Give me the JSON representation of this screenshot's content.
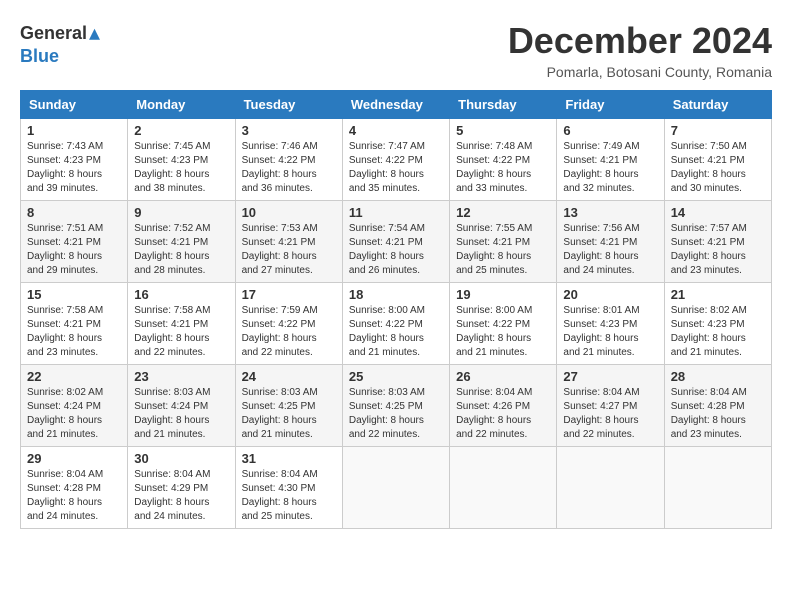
{
  "header": {
    "logo_general": "General",
    "logo_blue": "Blue",
    "month_title": "December 2024",
    "subtitle": "Pomarla, Botosani County, Romania"
  },
  "days_of_week": [
    "Sunday",
    "Monday",
    "Tuesday",
    "Wednesday",
    "Thursday",
    "Friday",
    "Saturday"
  ],
  "weeks": [
    [
      {
        "day": "1",
        "sunrise": "7:43 AM",
        "sunset": "4:23 PM",
        "daylight": "8 hours and 39 minutes."
      },
      {
        "day": "2",
        "sunrise": "7:45 AM",
        "sunset": "4:23 PM",
        "daylight": "8 hours and 38 minutes."
      },
      {
        "day": "3",
        "sunrise": "7:46 AM",
        "sunset": "4:22 PM",
        "daylight": "8 hours and 36 minutes."
      },
      {
        "day": "4",
        "sunrise": "7:47 AM",
        "sunset": "4:22 PM",
        "daylight": "8 hours and 35 minutes."
      },
      {
        "day": "5",
        "sunrise": "7:48 AM",
        "sunset": "4:22 PM",
        "daylight": "8 hours and 33 minutes."
      },
      {
        "day": "6",
        "sunrise": "7:49 AM",
        "sunset": "4:21 PM",
        "daylight": "8 hours and 32 minutes."
      },
      {
        "day": "7",
        "sunrise": "7:50 AM",
        "sunset": "4:21 PM",
        "daylight": "8 hours and 30 minutes."
      }
    ],
    [
      {
        "day": "8",
        "sunrise": "7:51 AM",
        "sunset": "4:21 PM",
        "daylight": "8 hours and 29 minutes."
      },
      {
        "day": "9",
        "sunrise": "7:52 AM",
        "sunset": "4:21 PM",
        "daylight": "8 hours and 28 minutes."
      },
      {
        "day": "10",
        "sunrise": "7:53 AM",
        "sunset": "4:21 PM",
        "daylight": "8 hours and 27 minutes."
      },
      {
        "day": "11",
        "sunrise": "7:54 AM",
        "sunset": "4:21 PM",
        "daylight": "8 hours and 26 minutes."
      },
      {
        "day": "12",
        "sunrise": "7:55 AM",
        "sunset": "4:21 PM",
        "daylight": "8 hours and 25 minutes."
      },
      {
        "day": "13",
        "sunrise": "7:56 AM",
        "sunset": "4:21 PM",
        "daylight": "8 hours and 24 minutes."
      },
      {
        "day": "14",
        "sunrise": "7:57 AM",
        "sunset": "4:21 PM",
        "daylight": "8 hours and 23 minutes."
      }
    ],
    [
      {
        "day": "15",
        "sunrise": "7:58 AM",
        "sunset": "4:21 PM",
        "daylight": "8 hours and 23 minutes."
      },
      {
        "day": "16",
        "sunrise": "7:58 AM",
        "sunset": "4:21 PM",
        "daylight": "8 hours and 22 minutes."
      },
      {
        "day": "17",
        "sunrise": "7:59 AM",
        "sunset": "4:22 PM",
        "daylight": "8 hours and 22 minutes."
      },
      {
        "day": "18",
        "sunrise": "8:00 AM",
        "sunset": "4:22 PM",
        "daylight": "8 hours and 21 minutes."
      },
      {
        "day": "19",
        "sunrise": "8:00 AM",
        "sunset": "4:22 PM",
        "daylight": "8 hours and 21 minutes."
      },
      {
        "day": "20",
        "sunrise": "8:01 AM",
        "sunset": "4:23 PM",
        "daylight": "8 hours and 21 minutes."
      },
      {
        "day": "21",
        "sunrise": "8:02 AM",
        "sunset": "4:23 PM",
        "daylight": "8 hours and 21 minutes."
      }
    ],
    [
      {
        "day": "22",
        "sunrise": "8:02 AM",
        "sunset": "4:24 PM",
        "daylight": "8 hours and 21 minutes."
      },
      {
        "day": "23",
        "sunrise": "8:03 AM",
        "sunset": "4:24 PM",
        "daylight": "8 hours and 21 minutes."
      },
      {
        "day": "24",
        "sunrise": "8:03 AM",
        "sunset": "4:25 PM",
        "daylight": "8 hours and 21 minutes."
      },
      {
        "day": "25",
        "sunrise": "8:03 AM",
        "sunset": "4:25 PM",
        "daylight": "8 hours and 22 minutes."
      },
      {
        "day": "26",
        "sunrise": "8:04 AM",
        "sunset": "4:26 PM",
        "daylight": "8 hours and 22 minutes."
      },
      {
        "day": "27",
        "sunrise": "8:04 AM",
        "sunset": "4:27 PM",
        "daylight": "8 hours and 22 minutes."
      },
      {
        "day": "28",
        "sunrise": "8:04 AM",
        "sunset": "4:28 PM",
        "daylight": "8 hours and 23 minutes."
      }
    ],
    [
      {
        "day": "29",
        "sunrise": "8:04 AM",
        "sunset": "4:28 PM",
        "daylight": "8 hours and 24 minutes."
      },
      {
        "day": "30",
        "sunrise": "8:04 AM",
        "sunset": "4:29 PM",
        "daylight": "8 hours and 24 minutes."
      },
      {
        "day": "31",
        "sunrise": "8:04 AM",
        "sunset": "4:30 PM",
        "daylight": "8 hours and 25 minutes."
      },
      null,
      null,
      null,
      null
    ]
  ]
}
